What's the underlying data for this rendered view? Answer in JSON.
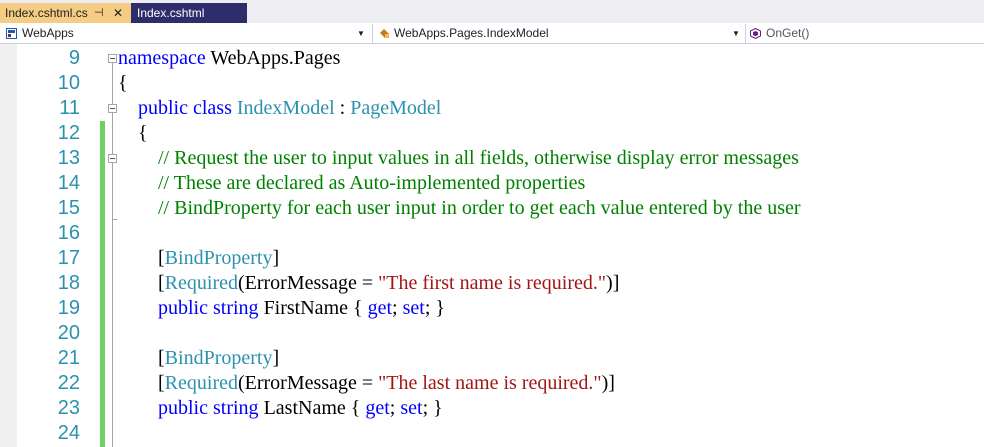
{
  "tabs": [
    {
      "label": "Index.cshtml.cs",
      "active": true,
      "pin_glyph": "⊣",
      "close_glyph": "✕"
    },
    {
      "label": "Index.cshtml",
      "active": false
    }
  ],
  "navbar": {
    "project": "WebApps",
    "type": "WebApps.Pages.IndexModel",
    "member": "OnGet()",
    "dropdown_glyph": "▼"
  },
  "line_numbers": [
    "9",
    "10",
    "11",
    "12",
    "13",
    "14",
    "15",
    "16",
    "17",
    "18",
    "19",
    "20",
    "21",
    "22",
    "23",
    "24"
  ],
  "code": {
    "l9": {
      "kw": "namespace",
      "name": " WebApps.Pages"
    },
    "l10": {
      "text": "{"
    },
    "l11": {
      "indent": "    ",
      "kw1": "public",
      "kw2": " class",
      "sp": " ",
      "type": "IndexModel",
      "sep": " : ",
      "base": "PageModel"
    },
    "l12": {
      "indent": "    ",
      "text": "{"
    },
    "l13": {
      "indent": "        ",
      "comment": "// Request the user to input values in all fields, otherwise display error messages"
    },
    "l14": {
      "indent": "        ",
      "comment": "// These are declared as Auto-implemented properties"
    },
    "l15": {
      "indent": "        ",
      "comment": "// BindProperty for each user input in order to get each value entered by the user"
    },
    "l16": {
      "text": ""
    },
    "l17": {
      "indent": "        ",
      "open": "[",
      "attr": "BindProperty",
      "close": "]"
    },
    "l18": {
      "indent": "        ",
      "open": "[",
      "attr": "Required",
      "mid": "(ErrorMessage = ",
      "str": "\"The first name is required.\"",
      "close": ")]"
    },
    "l19": {
      "indent": "        ",
      "kw1": "public",
      "kw2": " string",
      "name": " FirstName { ",
      "get": "get",
      "semi1": "; ",
      "set": "set",
      "tail": "; }"
    },
    "l20": {
      "text": ""
    },
    "l21": {
      "indent": "        ",
      "open": "[",
      "attr": "BindProperty",
      "close": "]"
    },
    "l22": {
      "indent": "        ",
      "open": "[",
      "attr": "Required",
      "mid": "(ErrorMessage = ",
      "str": "\"The last name is required.\"",
      "close": ")]"
    },
    "l23": {
      "indent": "        ",
      "kw1": "public",
      "kw2": " string",
      "name": " LastName { ",
      "get": "get",
      "semi1": "; ",
      "set": "set",
      "tail": "; }"
    },
    "l24": {
      "text": ""
    }
  },
  "colors": {
    "keyword": "#0000ff",
    "type": "#2b91af",
    "comment": "#008000",
    "string": "#a31515",
    "line_number": "#2b91af",
    "active_tab": "#f5cc84",
    "inactive_tab": "#2d2d6b",
    "change_bar": "#6ed168"
  },
  "icons": {
    "project": "csharp-project-icon",
    "type": "class-icon",
    "member": "method-icon"
  }
}
